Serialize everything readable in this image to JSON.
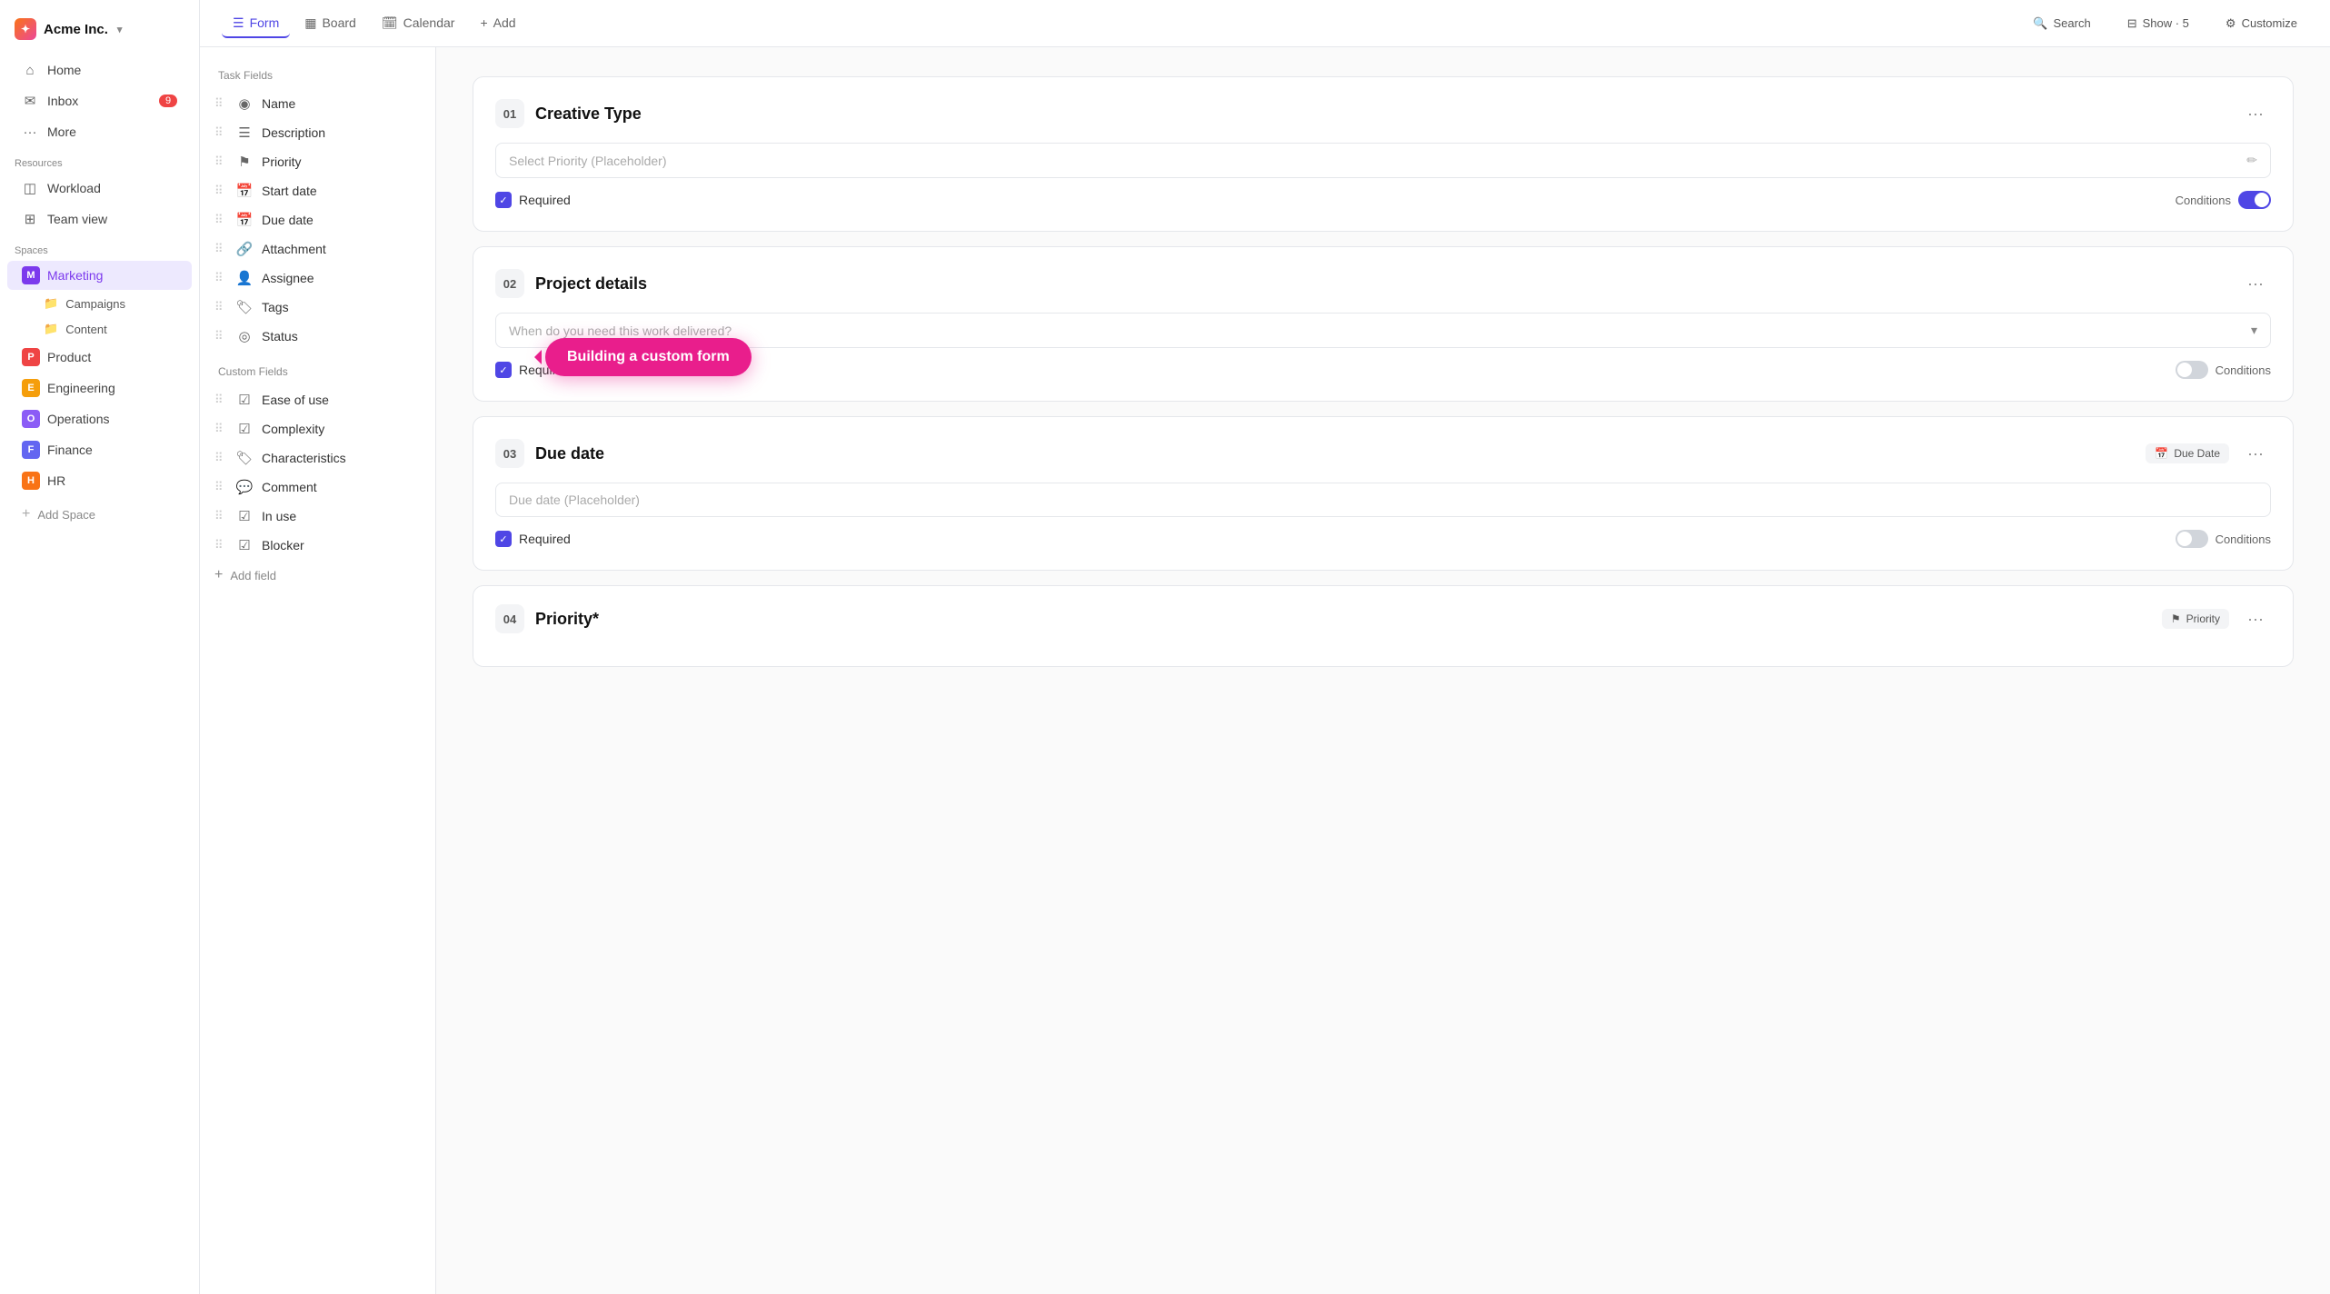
{
  "app": {
    "name": "Acme Inc.",
    "logo_icon": "sparkle"
  },
  "sidebar": {
    "nav_items": [
      {
        "id": "home",
        "label": "Home",
        "icon": "⌂"
      },
      {
        "id": "inbox",
        "label": "Inbox",
        "icon": "✉",
        "badge": "9"
      },
      {
        "id": "more",
        "label": "More",
        "icon": "⋯"
      }
    ],
    "resources_label": "Resources",
    "resources": [
      {
        "id": "workload",
        "label": "Workload",
        "icon": "◫"
      },
      {
        "id": "team-view",
        "label": "Team view",
        "icon": "⊞"
      }
    ],
    "spaces_label": "Spaces",
    "spaces": [
      {
        "id": "marketing",
        "label": "Marketing",
        "color": "m",
        "letter": "M",
        "active": true
      },
      {
        "id": "product",
        "label": "Product",
        "color": "p",
        "letter": "P",
        "active": false
      },
      {
        "id": "engineering",
        "label": "Engineering",
        "color": "e",
        "letter": "E",
        "active": false
      },
      {
        "id": "operations",
        "label": "Operations",
        "color": "o",
        "letter": "O",
        "active": false
      },
      {
        "id": "finance",
        "label": "Finance",
        "color": "f",
        "letter": "F",
        "active": false
      },
      {
        "id": "hr",
        "label": "HR",
        "color": "h",
        "letter": "H",
        "active": false
      }
    ],
    "marketing_sub": [
      {
        "id": "campaigns",
        "label": "Campaigns"
      },
      {
        "id": "content",
        "label": "Content"
      }
    ],
    "add_space": "Add Space"
  },
  "topbar": {
    "tabs": [
      {
        "id": "form",
        "label": "Form",
        "icon": "☰",
        "active": true
      },
      {
        "id": "board",
        "label": "Board",
        "icon": "▦",
        "active": false
      },
      {
        "id": "calendar",
        "label": "Calendar",
        "icon": "📅",
        "active": false
      }
    ],
    "add_label": "Add",
    "search_label": "Search",
    "show_label": "Show · 5",
    "customize_label": "Customize"
  },
  "fields_panel": {
    "task_fields_label": "Task Fields",
    "task_fields": [
      {
        "id": "name",
        "label": "Name",
        "icon": "◉"
      },
      {
        "id": "description",
        "label": "Description",
        "icon": "☰"
      },
      {
        "id": "priority",
        "label": "Priority",
        "icon": "⚑"
      },
      {
        "id": "start-date",
        "label": "Start date",
        "icon": "📅"
      },
      {
        "id": "due-date",
        "label": "Due date",
        "icon": "📅"
      },
      {
        "id": "attachment",
        "label": "Attachment",
        "icon": "🔗"
      },
      {
        "id": "assignee",
        "label": "Assignee",
        "icon": "👤"
      },
      {
        "id": "tags",
        "label": "Tags",
        "icon": "🏷"
      },
      {
        "id": "status",
        "label": "Status",
        "icon": "◎"
      }
    ],
    "custom_fields_label": "Custom Fields",
    "custom_fields": [
      {
        "id": "ease-of-use",
        "label": "Ease of use",
        "icon": "☑"
      },
      {
        "id": "complexity",
        "label": "Complexity",
        "icon": "☑"
      },
      {
        "id": "characteristics",
        "label": "Characteristics",
        "icon": "🏷"
      },
      {
        "id": "comment",
        "label": "Comment",
        "icon": "💬"
      },
      {
        "id": "in-use",
        "label": "In use",
        "icon": "☑"
      },
      {
        "id": "blocker",
        "label": "Blocker",
        "icon": "☑"
      }
    ],
    "add_field_label": "Add field"
  },
  "form_cards": [
    {
      "id": "card-1",
      "number": "01",
      "title": "Creative Type",
      "badge": null,
      "placeholder": "Select Priority (Placeholder)",
      "input_type": "text-edit",
      "required": true,
      "conditions_on": true
    },
    {
      "id": "card-2",
      "number": "02",
      "title": "Project details",
      "badge": null,
      "placeholder": "When do you need this work delivered?",
      "input_type": "dropdown",
      "required": true,
      "conditions_on": false
    },
    {
      "id": "card-3",
      "number": "03",
      "title": "Due date",
      "badge": "Due Date",
      "badge_icon": "📅",
      "placeholder": "Due date (Placeholder)",
      "input_type": "text",
      "required": true,
      "conditions_on": false
    },
    {
      "id": "card-4",
      "number": "04",
      "title": "Priority*",
      "badge": "Priority",
      "badge_icon": "⚑",
      "placeholder": null,
      "input_type": null,
      "required": null,
      "conditions_on": null,
      "partial": true
    }
  ],
  "tooltip": {
    "text": "Building a custom form"
  },
  "labels": {
    "required": "Required",
    "conditions": "Conditions"
  }
}
